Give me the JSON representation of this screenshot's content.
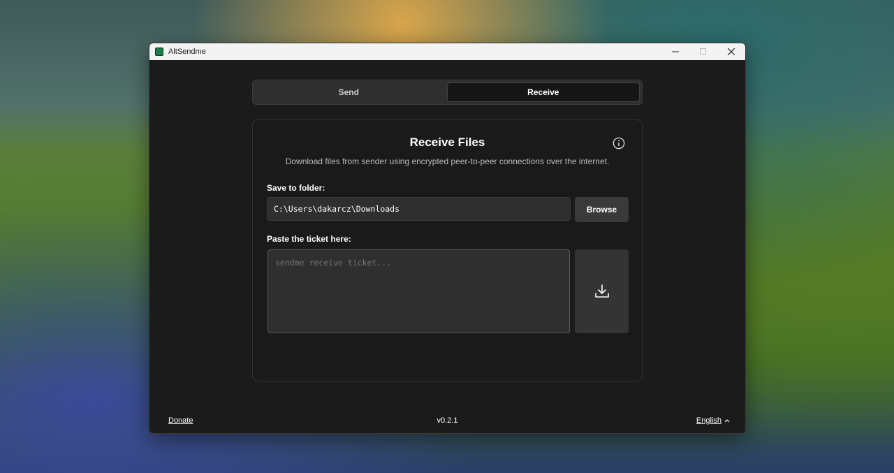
{
  "window": {
    "title": "AltSendme",
    "controls": {
      "minimize_icon": "minimize-icon",
      "maximize_icon": "maximize-icon",
      "close_icon": "close-icon"
    }
  },
  "tabs": [
    {
      "label": "Send",
      "active": false
    },
    {
      "label": "Receive",
      "active": true
    }
  ],
  "receive": {
    "title": "Receive Files",
    "subtitle": "Download files from sender using encrypted peer-to-peer connections over the internet.",
    "info_icon": "info-icon",
    "folder_label": "Save to folder:",
    "folder_value": "C:\\Users\\dakarcz\\Downloads",
    "browse_label": "Browse",
    "ticket_label": "Paste the ticket here:",
    "ticket_placeholder": "sendme receive ticket...",
    "download_icon": "download-icon"
  },
  "footer": {
    "donate_label": "Donate",
    "version": "v0.2.1",
    "language": "English",
    "language_icon": "chevron-up-icon"
  },
  "colors": {
    "window_bg": "#1b1b1b",
    "titlebar_bg": "#f3f3f3",
    "input_bg": "#2f2f2f",
    "button_bg": "#3a3a3a",
    "text": "#ffffff",
    "muted_text": "#bdbdbd"
  }
}
